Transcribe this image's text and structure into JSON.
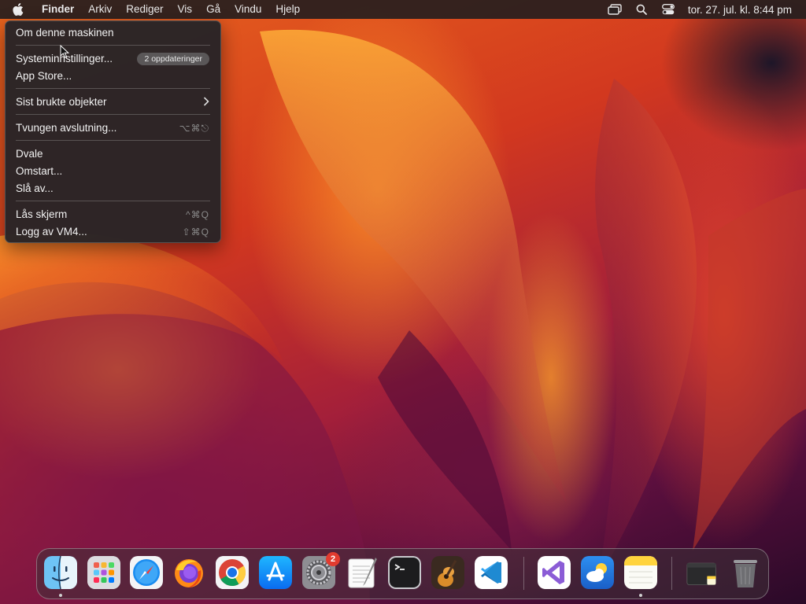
{
  "menubar": {
    "apple_icon": "apple-logo-icon",
    "app_name": "Finder",
    "menus": [
      "Arkiv",
      "Rediger",
      "Vis",
      "Gå",
      "Vindu",
      "Hjelp"
    ],
    "status_icons": [
      "screen-mirroring-icon",
      "spotlight-search-icon",
      "control-center-icon"
    ],
    "clock": "tor. 27. jul. kl. 8:44 pm"
  },
  "apple_menu": {
    "items": [
      {
        "label": "Om denne maskinen"
      },
      {
        "label": "Systeminnstillinger...",
        "badge": "2 oppdateringer"
      },
      {
        "label": "App Store..."
      },
      {
        "label": "Sist brukte objekter",
        "submenu_icon": "chevron-right-icon"
      },
      {
        "label": "Tvungen avslutning...",
        "shortcut": "⌥⌘⎋"
      },
      {
        "label": "Dvale"
      },
      {
        "label": "Omstart..."
      },
      {
        "label": "Slå av..."
      },
      {
        "label": "Lås skjerm",
        "shortcut": "^⌘Q"
      },
      {
        "label": "Logg av VM4...",
        "shortcut": "⇧⌘Q"
      }
    ]
  },
  "dock": {
    "apps": [
      {
        "icon": "finder-icon",
        "running": true
      },
      {
        "icon": "launchpad-icon",
        "running": false
      },
      {
        "icon": "safari-icon",
        "running": false
      },
      {
        "icon": "firefox-icon",
        "running": false
      },
      {
        "icon": "chrome-icon",
        "running": false
      },
      {
        "icon": "app-store-icon",
        "running": false
      },
      {
        "icon": "system-settings-icon",
        "running": false,
        "badge": "2"
      },
      {
        "icon": "textedit-icon",
        "running": false
      },
      {
        "icon": "terminal-icon",
        "running": false
      },
      {
        "icon": "garageband-icon",
        "running": false
      },
      {
        "icon": "vscode-icon",
        "running": false
      },
      {
        "icon": "visual-studio-icon",
        "running": false
      },
      {
        "icon": "weather-icon",
        "running": false
      },
      {
        "icon": "notes-icon",
        "running": true
      },
      {
        "icon": "downloads-stack-icon",
        "running": false
      },
      {
        "icon": "trash-icon",
        "running": false
      }
    ]
  }
}
